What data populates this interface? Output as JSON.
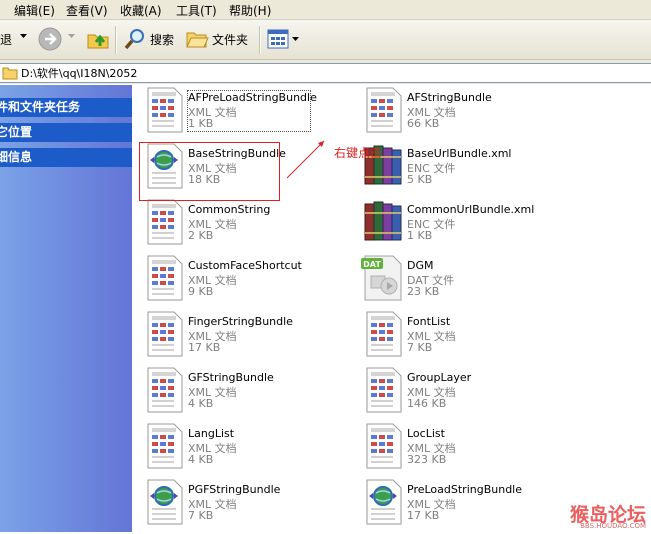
{
  "menu": {
    "items": [
      "编辑(E)",
      "查看(V)",
      "收藏(A)",
      "工具(T)",
      "帮助(H)"
    ]
  },
  "toolbar": {
    "back_label": "退",
    "search_label": "搜索",
    "folders_label": "文件夹"
  },
  "address": {
    "path": "D:\\软件\\qq\\I18N\\2052"
  },
  "left_pane": {
    "panels": [
      "件和文件夹任务",
      "它位置",
      "细信息"
    ]
  },
  "files": [
    {
      "name": "AFPreLoadStringBundle",
      "type": "XML 文档",
      "size": "1 KB",
      "icon": "xml-doc-icon"
    },
    {
      "name": "AFStringBundle",
      "type": "XML 文档",
      "size": "66 KB",
      "icon": "xml-doc-icon"
    },
    {
      "name": "BaseStringBundle",
      "type": "XML 文档",
      "size": "18 KB",
      "icon": "xml-web-icon"
    },
    {
      "name": "BaseUrlBundle.xml",
      "type": "ENC 文件",
      "size": "5 KB",
      "icon": "books-icon"
    },
    {
      "name": "CommonString",
      "type": "XML 文档",
      "size": "2 KB",
      "icon": "xml-doc-icon"
    },
    {
      "name": "CommonUrlBundle.xml",
      "type": "ENC 文件",
      "size": "1 KB",
      "icon": "books-icon"
    },
    {
      "name": "CustomFaceShortcut",
      "type": "XML 文档",
      "size": "9 KB",
      "icon": "xml-doc-icon"
    },
    {
      "name": "DGM",
      "type": "DAT 文件",
      "size": "23 KB",
      "icon": "dat-file-icon"
    },
    {
      "name": "FingerStringBundle",
      "type": "XML 文档",
      "size": "17 KB",
      "icon": "xml-doc-icon"
    },
    {
      "name": "FontList",
      "type": "XML 文档",
      "size": "7 KB",
      "icon": "xml-doc-icon"
    },
    {
      "name": "GFStringBundle",
      "type": "XML 文档",
      "size": "4 KB",
      "icon": "xml-doc-icon"
    },
    {
      "name": "GroupLayer",
      "type": "XML 文档",
      "size": "146 KB",
      "icon": "xml-doc-icon"
    },
    {
      "name": "LangList",
      "type": "XML 文档",
      "size": "4 KB",
      "icon": "xml-doc-icon"
    },
    {
      "name": "LocList",
      "type": "XML 文档",
      "size": "323 KB",
      "icon": "xml-doc-icon"
    },
    {
      "name": "PGFStringBundle",
      "type": "XML 文档",
      "size": "7 KB",
      "icon": "xml-web-icon"
    },
    {
      "name": "PreLoadStringBundle",
      "type": "XML 文档",
      "size": "17 KB",
      "icon": "xml-web-icon"
    }
  ],
  "annotation": {
    "label": "右键点击",
    "color": "#e02020"
  },
  "watermark": {
    "text": "猴岛论坛",
    "url": "BBS.HOUDAO.COM"
  },
  "colors": {
    "panel_header": "#1d5cc8",
    "left_pane": "#6f8fe0",
    "annotation": "#e02020"
  }
}
